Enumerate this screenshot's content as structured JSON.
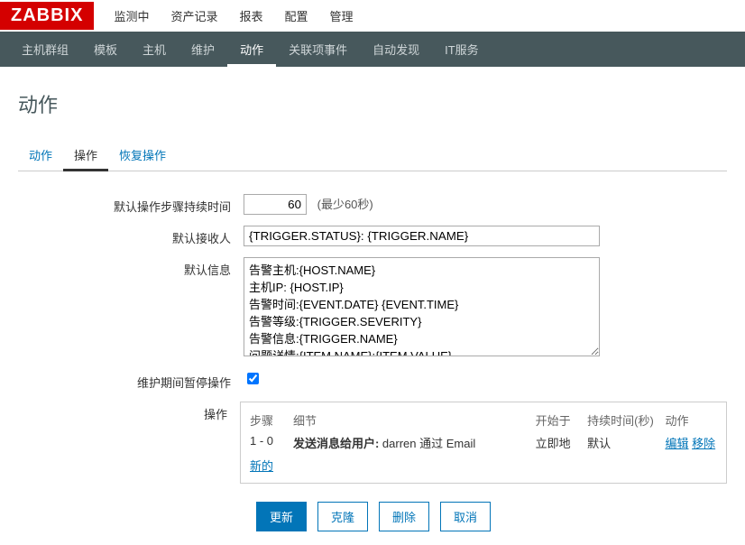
{
  "logo": "ZABBIX",
  "topnav": [
    "监测中",
    "资产记录",
    "报表",
    "配置",
    "管理"
  ],
  "topnavActive": 3,
  "subnav": [
    "主机群组",
    "模板",
    "主机",
    "维护",
    "动作",
    "关联项事件",
    "自动发现",
    "IT服务"
  ],
  "subnavActive": 4,
  "pageTitle": "动作",
  "tabs": [
    "动作",
    "操作",
    "恢复操作"
  ],
  "tabActive": 1,
  "form": {
    "stepDurationLabel": "默认操作步骤持续时间",
    "stepDurationValue": "60",
    "stepDurationHint": "(最少60秒)",
    "recipientLabel": "默认接收人",
    "recipientValue": "{TRIGGER.STATUS}: {TRIGGER.NAME}",
    "infoLabel": "默认信息",
    "infoValue": "告警主机:{HOST.NAME}\n主机IP: {HOST.IP}\n告警时间:{EVENT.DATE} {EVENT.TIME}\n告警等级:{TRIGGER.SEVERITY}\n告警信息:{TRIGGER.NAME}\n问题详情:{ITEM.NAME}:{ITEM.VALUE}\n事件ID: {EVENT.ID}",
    "pauseLabel": "维护期间暂停操作",
    "pauseChecked": true,
    "opsLabel": "操作"
  },
  "opTable": {
    "headers": {
      "step": "步骤",
      "detail": "细节",
      "start": "开始于",
      "dur": "持续时间(秒)",
      "act": "动作"
    },
    "row": {
      "step": "1 - 0",
      "detailPrefix": "发送消息给用户:",
      "detailRest": " darren 通过 Email",
      "start": "立即地",
      "dur": "默认",
      "edit": "编辑",
      "remove": "移除"
    },
    "newLink": "新的"
  },
  "buttons": {
    "update": "更新",
    "clone": "克隆",
    "delete": "删除",
    "cancel": "取消"
  }
}
